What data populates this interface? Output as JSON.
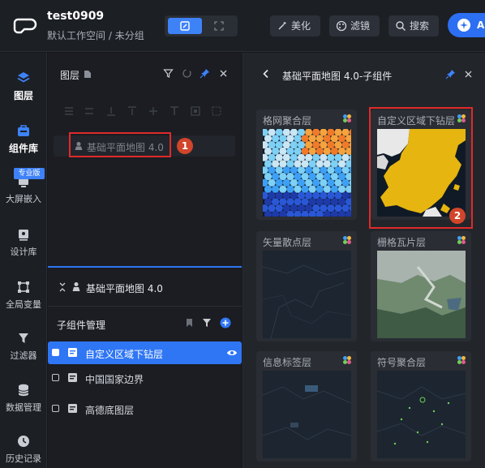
{
  "header": {
    "project_title": "test0909",
    "workspace": "默认工作空间",
    "separator": "/",
    "group": "未分组",
    "buttons": [
      {
        "label": "美化",
        "icon": "magic-wand-icon"
      },
      {
        "label": "滤镜",
        "icon": "palette-icon"
      },
      {
        "label": "搜索",
        "icon": "search-icon"
      }
    ],
    "ai_label": "A"
  },
  "leftnav": {
    "items": [
      {
        "label": "图层",
        "icon": "layers-icon",
        "active": true
      },
      {
        "label": "组件库",
        "icon": "component-icon",
        "active": true
      },
      {
        "label": "大屏嵌入",
        "icon": "screen-embed-icon",
        "badge": "专业版"
      },
      {
        "label": "设计库",
        "icon": "design-library-icon"
      },
      {
        "label": "全局变量",
        "icon": "global-variable-icon"
      },
      {
        "label": "过滤器",
        "icon": "filter-icon"
      },
      {
        "label": "数据管理",
        "icon": "database-icon"
      },
      {
        "label": "历史记录",
        "icon": "history-icon"
      }
    ]
  },
  "layers": {
    "title": "图层",
    "layer_name": "基础平面地图 4.0",
    "annotation_1": "1",
    "sub_header_label": "基础平面地图 4.0",
    "sub_manager_label": "子组件管理",
    "sub_items": [
      {
        "label": "自定义区域下钻层",
        "active": true
      },
      {
        "label": "中国国家边界",
        "active": false
      },
      {
        "label": "高德底图层",
        "active": false
      }
    ]
  },
  "right_panel": {
    "title": "基础平面地图 4.0-子组件",
    "cards": [
      {
        "title": "格网聚合层"
      },
      {
        "title": "自定义区域下钻层"
      },
      {
        "title": "矢量散点层"
      },
      {
        "title": "栅格瓦片层"
      },
      {
        "title": "信息标签层"
      },
      {
        "title": "符号聚合层"
      }
    ],
    "annotation_2": "2"
  },
  "colors": {
    "accent": "#2f76f5",
    "annotation_red": "#e02a2a",
    "badge_orange": "#d1452b"
  }
}
